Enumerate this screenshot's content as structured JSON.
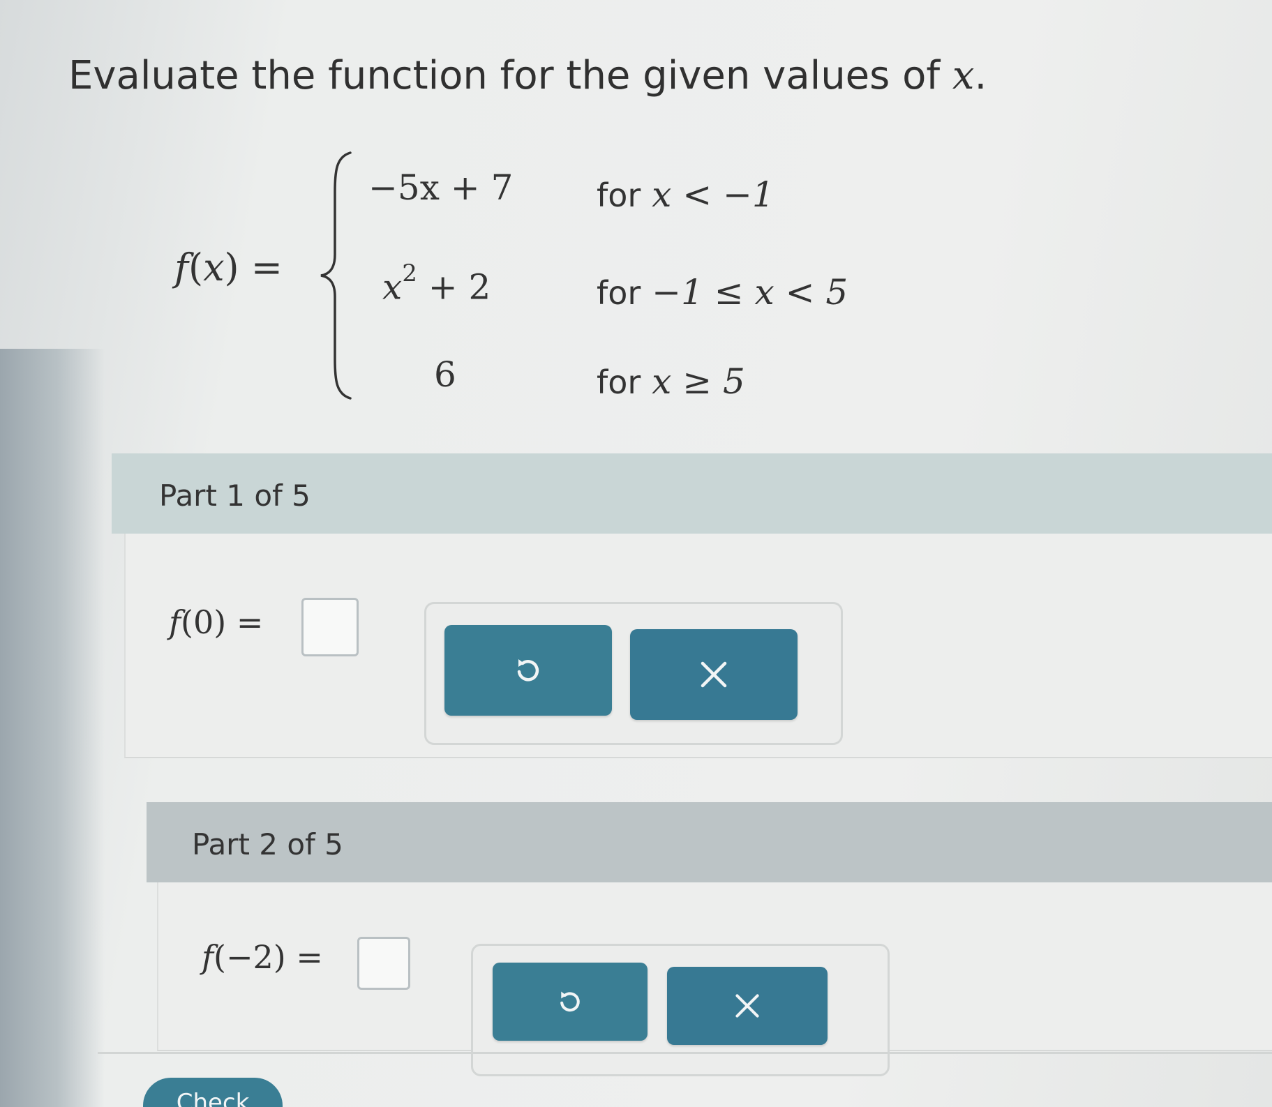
{
  "instruction": {
    "text": "Evaluate the function for the given values of ",
    "variable": "x",
    "suffix": "."
  },
  "function": {
    "label_fn": "f",
    "label_arg": "x",
    "equals": "=",
    "cases": [
      {
        "expression": "−5x + 7",
        "for": "for",
        "condition": "x < −1"
      },
      {
        "expression_base": "x",
        "expression_exp": "2",
        "expression_rest": " + 2",
        "for": "for",
        "condition": "−1 ≤ x < 5"
      },
      {
        "expression": "6",
        "for": "for",
        "condition": "x ≥ 5"
      }
    ]
  },
  "parts": [
    {
      "title": "Part 1 of 5",
      "fn": "f",
      "arg": "0",
      "equals": "=",
      "answer_value": ""
    },
    {
      "title": "Part 2 of 5",
      "fn": "f",
      "arg": "−2",
      "equals": "=",
      "answer_value": ""
    }
  ],
  "buttons": {
    "undo_icon": "undo-icon",
    "clear_icon": "clear-x-icon",
    "check_label": "Check"
  },
  "colors": {
    "button": "#3a7e94",
    "part1_header": "#c9d6d6",
    "part2_header": "#bcc4c6"
  }
}
